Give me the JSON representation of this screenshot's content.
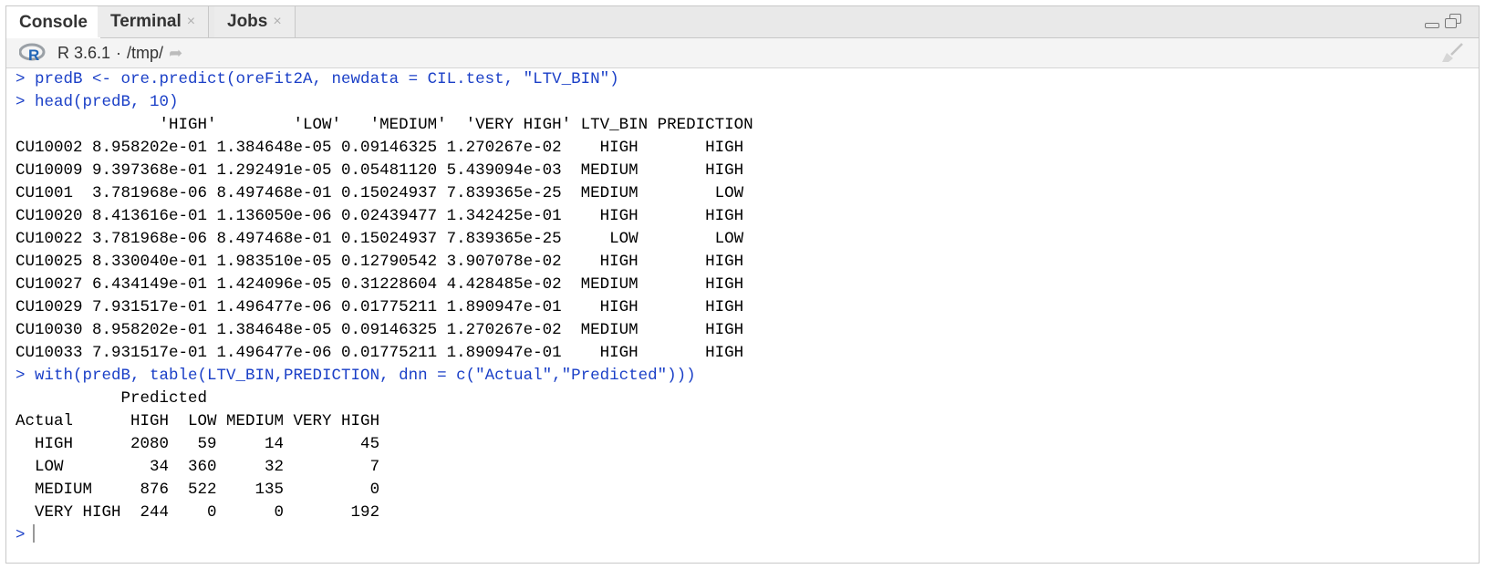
{
  "tabs": [
    {
      "label": "Console",
      "active": true,
      "closable": false
    },
    {
      "label": "Terminal",
      "active": false,
      "closable": true
    },
    {
      "label": "Jobs",
      "active": false,
      "closable": true
    }
  ],
  "pathbar": {
    "r_version": "R 3.6.1",
    "separator": "·",
    "path": "/tmp/"
  },
  "colors": {
    "command": "#1a3fc7",
    "output": "#000000"
  },
  "console": {
    "lines": [
      {
        "type": "command",
        "text": "> predB <- ore.predict(oreFit2A, newdata = CIL.test, \"LTV_BIN\")"
      },
      {
        "type": "command",
        "text": "> head(predB, 10)"
      },
      {
        "type": "output",
        "text": "               'HIGH'        'LOW'   'MEDIUM'  'VERY HIGH' LTV_BIN PREDICTION"
      },
      {
        "type": "output",
        "text": "CU10002 8.958202e-01 1.384648e-05 0.09146325 1.270267e-02    HIGH       HIGH"
      },
      {
        "type": "output",
        "text": "CU10009 9.397368e-01 1.292491e-05 0.05481120 5.439094e-03  MEDIUM       HIGH"
      },
      {
        "type": "output",
        "text": "CU1001  3.781968e-06 8.497468e-01 0.15024937 7.839365e-25  MEDIUM        LOW"
      },
      {
        "type": "output",
        "text": "CU10020 8.413616e-01 1.136050e-06 0.02439477 1.342425e-01    HIGH       HIGH"
      },
      {
        "type": "output",
        "text": "CU10022 3.781968e-06 8.497468e-01 0.15024937 7.839365e-25     LOW        LOW"
      },
      {
        "type": "output",
        "text": "CU10025 8.330040e-01 1.983510e-05 0.12790542 3.907078e-02    HIGH       HIGH"
      },
      {
        "type": "output",
        "text": "CU10027 6.434149e-01 1.424096e-05 0.31228604 4.428485e-02  MEDIUM       HIGH"
      },
      {
        "type": "output",
        "text": "CU10029 7.931517e-01 1.496477e-06 0.01775211 1.890947e-01    HIGH       HIGH"
      },
      {
        "type": "output",
        "text": "CU10030 8.958202e-01 1.384648e-05 0.09146325 1.270267e-02  MEDIUM       HIGH"
      },
      {
        "type": "output",
        "text": "CU10033 7.931517e-01 1.496477e-06 0.01775211 1.890947e-01    HIGH       HIGH"
      },
      {
        "type": "command",
        "text": "> with(predB, table(LTV_BIN,PREDICTION, dnn = c(\"Actual\",\"Predicted\")))"
      },
      {
        "type": "output",
        "text": "           Predicted"
      },
      {
        "type": "output",
        "text": "Actual      HIGH  LOW MEDIUM VERY HIGH"
      },
      {
        "type": "output",
        "text": "  HIGH      2080   59     14        45"
      },
      {
        "type": "output",
        "text": "  LOW         34  360     32         7"
      },
      {
        "type": "output",
        "text": "  MEDIUM     876  522    135         0"
      },
      {
        "type": "output",
        "text": "  VERY HIGH  244    0      0       192"
      }
    ],
    "prompt": ">"
  }
}
